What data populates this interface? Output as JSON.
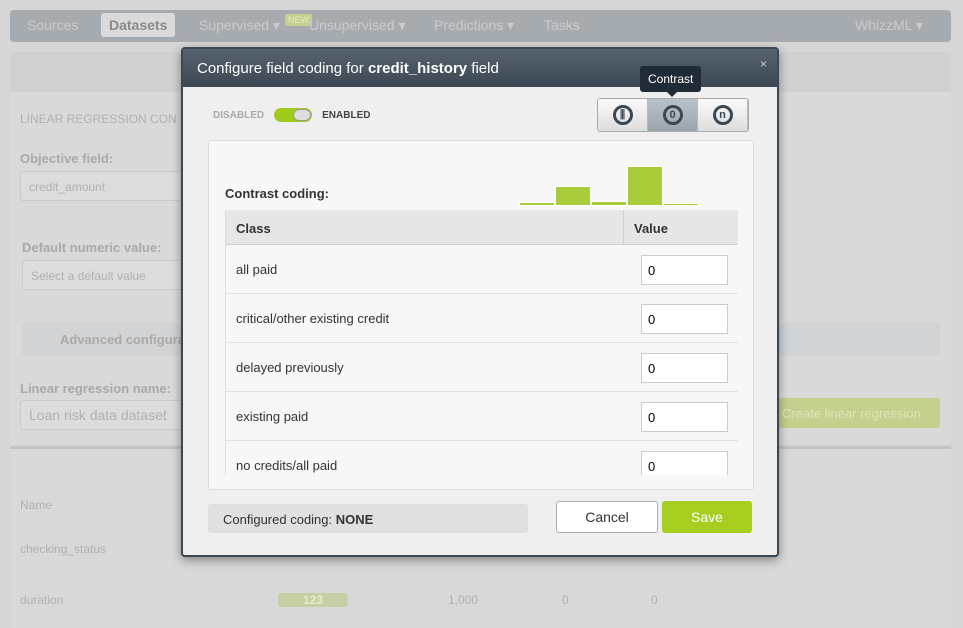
{
  "nav": {
    "items": [
      "Sources",
      "Datasets",
      "Supervised ▾",
      "Unsupervised ▾",
      "Predictions ▾",
      "Tasks"
    ],
    "new_badge": "NEW",
    "right": "WhizzML ▾"
  },
  "form": {
    "section_title": "LINEAR REGRESSION CON",
    "objective_label": "Objective field:",
    "objective_value": "credit_amount",
    "default_label": "Default numeric value:",
    "default_placeholder": "Select a default value",
    "advanced_label": "Advanced configura",
    "name_label": "Linear regression name:",
    "name_value": "Loan risk data dataset",
    "create_label": "Create linear regression"
  },
  "fields": {
    "header_name": "Name",
    "rows": [
      {
        "name": "checking_status"
      },
      {
        "name": "duration",
        "type": "123",
        "count": "1,000",
        "missing": "0",
        "errors": "0"
      }
    ]
  },
  "modal": {
    "title_prefix": "Configure field coding for ",
    "field": "credit_history",
    "title_suffix": " field",
    "close": "×",
    "tooltip": "Contrast",
    "disabled": "DISABLED",
    "enabled": "ENABLED",
    "toggle_on": true,
    "codings": [
      {
        "name": "dummy",
        "icon": "sliders-icon"
      },
      {
        "name": "contrast",
        "icon": "contrast-icon",
        "active": true
      },
      {
        "name": "other",
        "icon": "n-icon"
      }
    ],
    "coding_title": "Contrast coding:",
    "histogram": [
      0.1,
      0.5,
      0.12,
      1.0,
      0.08
    ],
    "columns": [
      "Class",
      "Value"
    ],
    "rows": [
      {
        "class": "all paid",
        "value": "0"
      },
      {
        "class": "critical/other existing credit",
        "value": "0"
      },
      {
        "class": "delayed previously",
        "value": "0"
      },
      {
        "class": "existing paid",
        "value": "0"
      },
      {
        "class": "no credits/all paid",
        "value": "0"
      }
    ],
    "configured_label": "Configured coding: ",
    "configured_value": "NONE",
    "cancel": "Cancel",
    "save": "Save"
  },
  "colors": {
    "accent": "#a7cd1e",
    "header": "#3c4954"
  }
}
